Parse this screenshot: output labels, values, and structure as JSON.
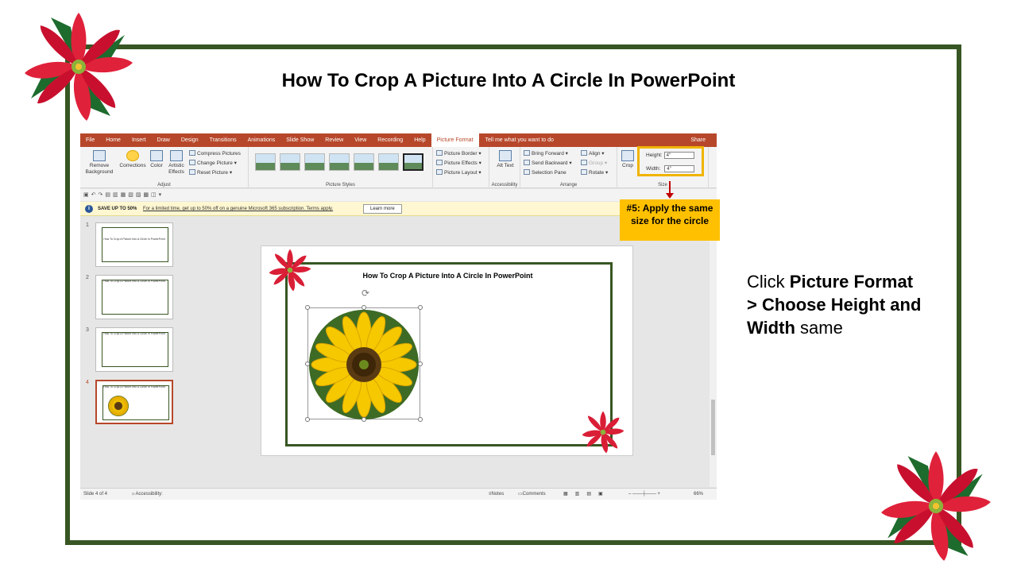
{
  "title": "How To Crop A Picture Into A Circle In PowerPoint",
  "tabs": [
    "File",
    "Home",
    "Insert",
    "Draw",
    "Design",
    "Transitions",
    "Animations",
    "Slide Show",
    "Review",
    "View",
    "Recording",
    "Help",
    "Picture Format"
  ],
  "tellme": "Tell me what you want to do",
  "share": "Share",
  "ribbon": {
    "remove_bg": "Remove Background",
    "corrections": "Corrections",
    "color": "Color",
    "artistic": "Artistic Effects",
    "compress": "Compress Pictures",
    "change": "Change Picture",
    "reset": "Reset Picture",
    "adjust": "Adjust",
    "styles": "Picture Styles",
    "border": "Picture Border",
    "effects": "Picture Effects",
    "layout": "Picture Layout",
    "alt": "Alt Text",
    "accessibility": "Accessibility",
    "bring": "Bring Forward",
    "send": "Send Backward",
    "selpane": "Selection Pane",
    "align": "Align",
    "group": "Group",
    "rotate": "Rotate",
    "arrange": "Arrange",
    "crop": "Crop",
    "height_label": "Height:",
    "height_val": "4\"",
    "width_label": "Width:",
    "width_val": "4\"",
    "size": "Size"
  },
  "notice": {
    "bold": "SAVE UP TO 50%",
    "text": "For a limited time, get up to 50% off on a genuine Microsoft 365 subscription. Terms apply.",
    "button": "Learn more"
  },
  "thumbs": [
    {
      "num": "1",
      "title": "How To Crop A Picture Into A Circle In PowerPoint"
    },
    {
      "num": "2",
      "title": "How To Crop A Picture Into A Circle In PowerPoint"
    },
    {
      "num": "3",
      "title": "How To Crop A Picture Into A Circle In PowerPoint"
    },
    {
      "num": "4",
      "title": "How To Crop A Picture Into A Circle In PowerPoint"
    }
  ],
  "slide_title": "How To Crop A Picture Into A Circle In PowerPoint",
  "status": {
    "slide": "Slide 4 of 4",
    "access": "Accessibility: Investigate",
    "notes": "Notes",
    "comments": "Comments",
    "zoom": "66%"
  },
  "callout": "#5: Apply the same size for the circle",
  "instr": {
    "click": "Click ",
    "b1": "Picture Format > Choose Height and Width",
    "same": " same"
  },
  "colors": {
    "frame": "#375623",
    "tab_bar": "#b7472a",
    "callout": "#ffc000",
    "arrow": "#c00000"
  }
}
